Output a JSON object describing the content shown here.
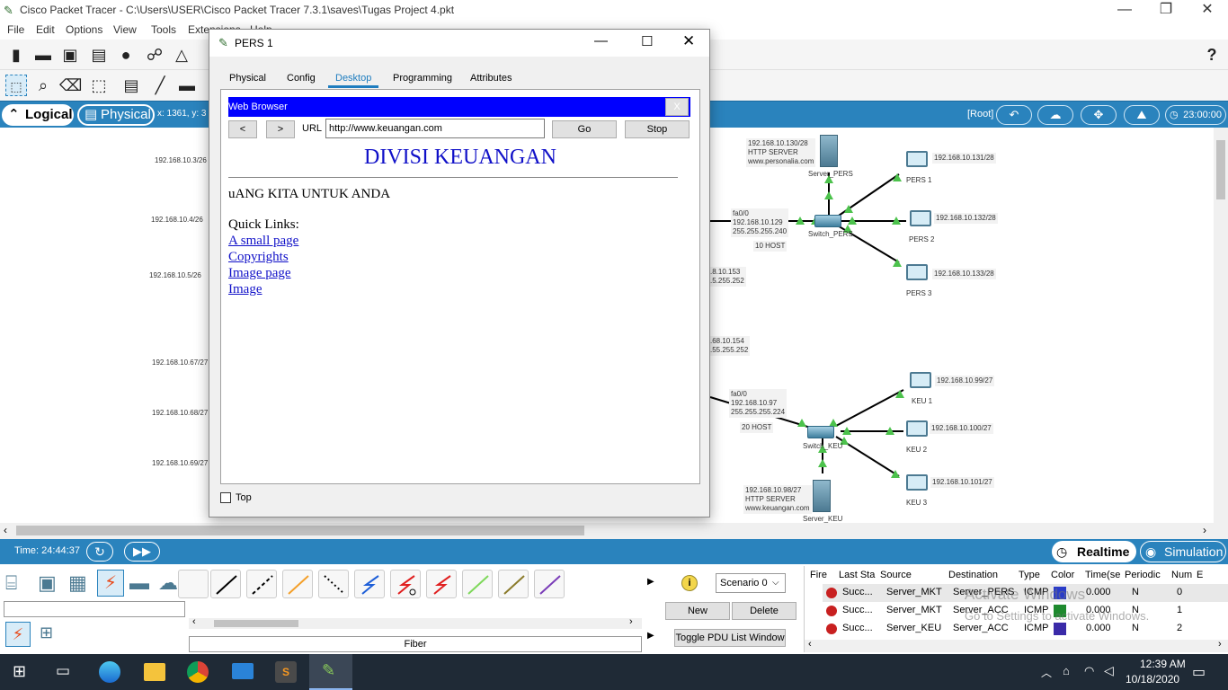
{
  "app": {
    "title": "Cisco Packet Tracer - C:\\Users\\USER\\Cisco Packet Tracer 7.3.1\\saves\\Tugas Project 4.pkt",
    "menu": [
      "File",
      "Edit",
      "Options",
      "View",
      "Tools",
      "Extensions",
      "Help"
    ],
    "help_icon": "?"
  },
  "bluebar": {
    "logical_label": "Logical",
    "physical_label": "Physical",
    "coords": "x: 1361, y: 3",
    "root_label": "[Root]",
    "clock": "23:00:00"
  },
  "workspace": {
    "left_labels": [
      "192.168.10.3/26",
      "192.168.10.4/26",
      "192.168.10.5/26",
      "192.168.10.67/27",
      "192.168.10.68/27",
      "192.168.10.69/27"
    ],
    "pers": {
      "server_info": [
        "192.168.10.130/28",
        "HTTP SERVER",
        "www.personalia.com"
      ],
      "server_name": "Server_PERS",
      "switch_name": "Switch_PERS",
      "iface": [
        "fa0/0",
        "192.168.10.129",
        "255.255.255.240"
      ],
      "host_count": "10 HOST",
      "pcs": [
        {
          "ip": "192.168.10.131/28",
          "name": "PERS 1"
        },
        {
          "ip": "192.168.10.132/28",
          "name": "PERS 2"
        },
        {
          "ip": "192.168.10.133/28",
          "name": "PERS 3"
        }
      ],
      "partial1": [
        ".8.10.153",
        ".5.255.252"
      ],
      "partial2": [
        ".68.10.154",
        ".55.255.252"
      ]
    },
    "keu": {
      "iface": [
        "fa0/0",
        "192.168.10.97",
        "255.255.255.224"
      ],
      "host_count": "20 HOST",
      "switch_name": "Switch_KEU",
      "server_info": [
        "192.168.10.98/27",
        "HTTP SERVER",
        "www.keuangan.com"
      ],
      "server_name": "Server_KEU",
      "pcs": [
        {
          "ip": "192.168.10.99/27",
          "name": "KEU 1"
        },
        {
          "ip": "192.168.10.100/27",
          "name": "KEU 2"
        },
        {
          "ip": "192.168.10.101/27",
          "name": "KEU 3"
        }
      ]
    }
  },
  "dialog": {
    "title": "PERS 1",
    "tabs": [
      "Physical",
      "Config",
      "Desktop",
      "Programming",
      "Attributes"
    ],
    "active_tab": "Desktop",
    "browser": {
      "header": "Web Browser",
      "close": "X",
      "back": "<",
      "forward": ">",
      "url_label": "URL",
      "url": "http://www.keuangan.com",
      "go": "Go",
      "stop": "Stop",
      "page_title": "DIVISI KEUANGAN",
      "tagline": "uANG KITA UNTUK ANDA",
      "quick_links_label": "Quick Links:",
      "links": [
        "A small page",
        "Copyrights",
        "Image page",
        "Image"
      ]
    },
    "top_checkbox": "Top"
  },
  "timebar": {
    "time": "Time: 24:44:37",
    "realtime": "Realtime",
    "simulation": "Simulation"
  },
  "bottom": {
    "cable_label": "Fiber",
    "scenario": "Scenario 0",
    "new_btn": "New",
    "delete_btn": "Delete",
    "toggle_btn": "Toggle PDU List Window",
    "columns": [
      "Fire",
      "Last Sta",
      "Source",
      "Destination",
      "Type",
      "Color",
      "Time(se",
      "Periodic",
      "Num",
      "E"
    ],
    "rows": [
      {
        "status": "Succ...",
        "source": "Server_MKT",
        "dest": "Server_PERS",
        "type": "ICMP",
        "color": "#2a3cc8",
        "time": "0.000",
        "periodic": "N",
        "num": "0"
      },
      {
        "status": "Succ...",
        "source": "Server_MKT",
        "dest": "Server_ACC",
        "type": "ICMP",
        "color": "#1e8a2e",
        "time": "0.000",
        "periodic": "N",
        "num": "1"
      },
      {
        "status": "Succ...",
        "source": "Server_KEU",
        "dest": "Server_ACC",
        "type": "ICMP",
        "color": "#3a2aa8",
        "time": "0.000",
        "periodic": "N",
        "num": "2"
      }
    ],
    "watermark1": "Activate Windows",
    "watermark2": "Go to Settings to activate Windows."
  },
  "taskbar": {
    "time": "12:39 AM",
    "date": "10/18/2020"
  }
}
